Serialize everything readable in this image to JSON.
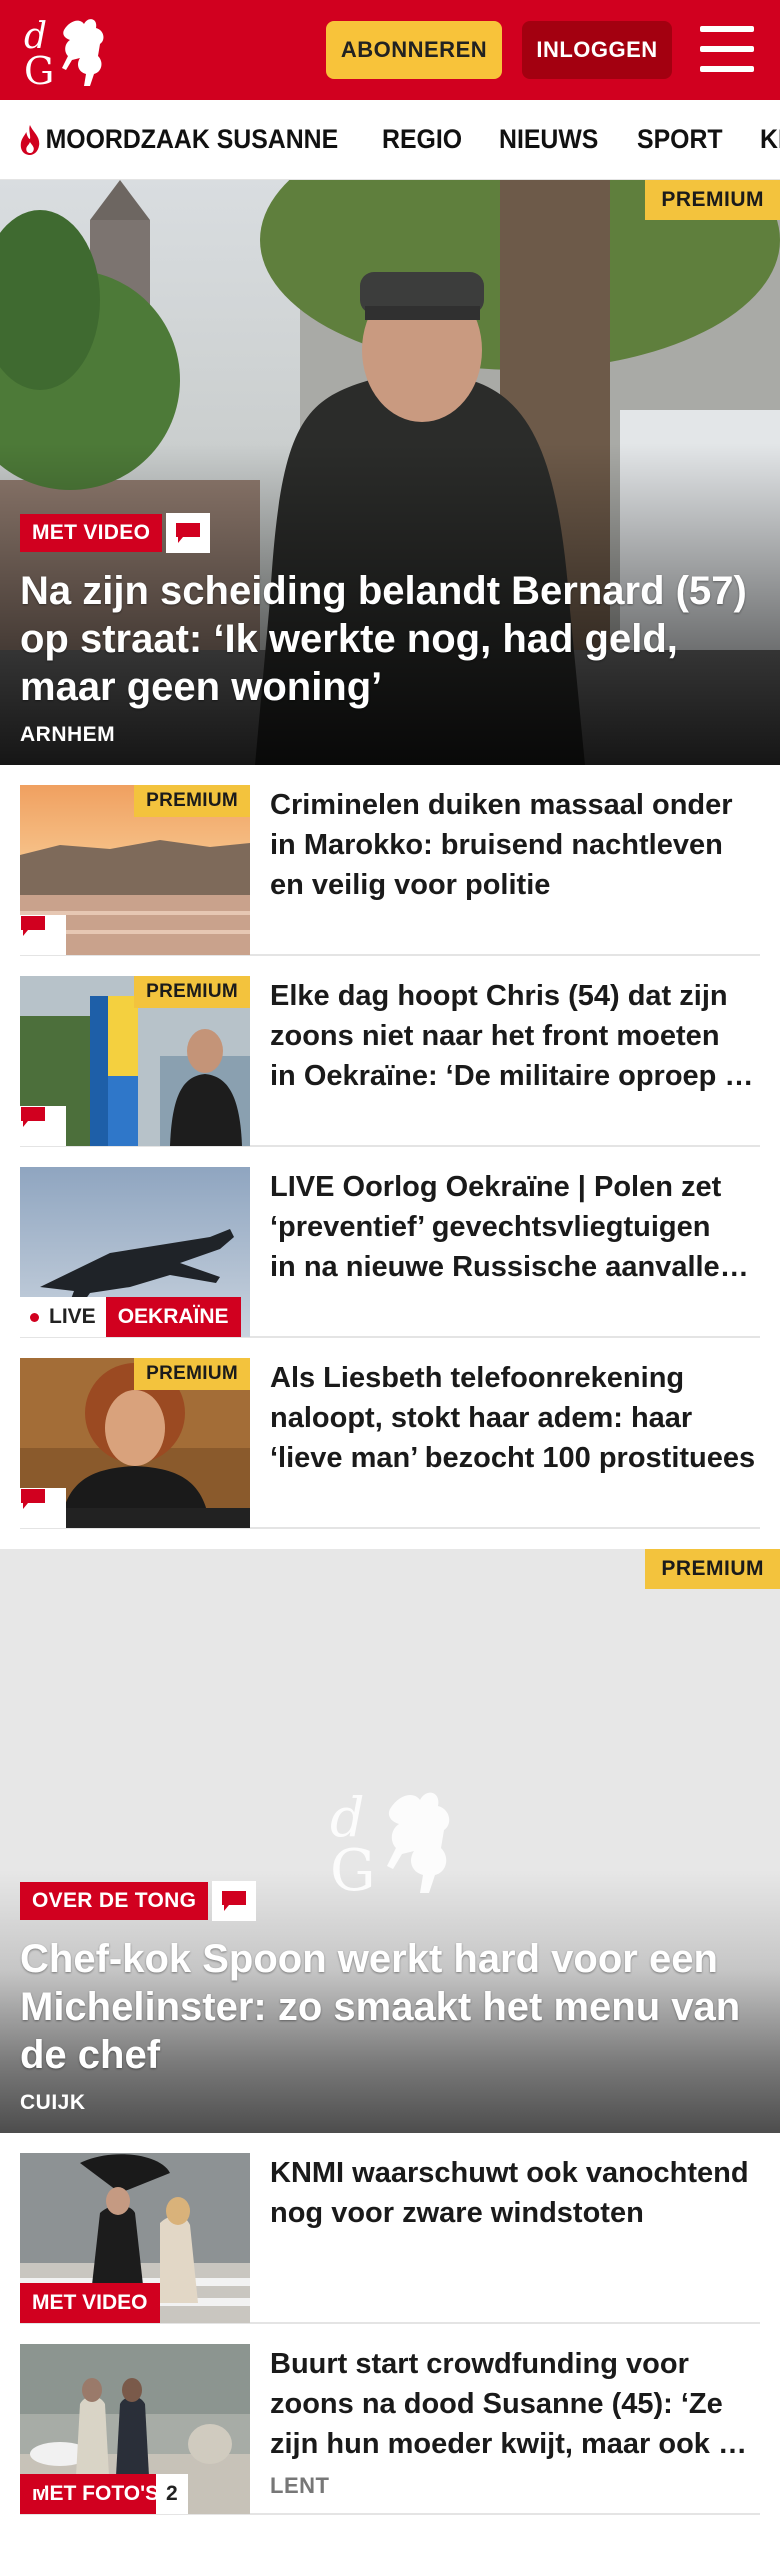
{
  "header": {
    "logo_text": "dG",
    "subscribe_label": "ABONNEREN",
    "login_label": "INLOGGEN",
    "brand_color": "#d1001f",
    "subscribe_color": "#f8c33a",
    "login_color": "#a30010"
  },
  "nav": {
    "items": [
      {
        "label": "MOORDZAAK SUSANNE",
        "icon": "flame-icon"
      },
      {
        "label": "REGIO"
      },
      {
        "label": "NIEUWS"
      },
      {
        "label": "SPORT"
      },
      {
        "label": "KIJK"
      }
    ]
  },
  "hero": {
    "premium_label": "PREMIUM",
    "tag": "MET VIDEO",
    "title": "Na zijn scheiding belandt Bernard (57) op straat: ‘Ik werkte nog, had geld, maar geen woning’",
    "location": "ARNHEM"
  },
  "articles": [
    {
      "title": "Criminelen duiken massaal onder in Marokko: bruisend nachtleven en veilig voor politie",
      "premium_label": "PREMIUM"
    },
    {
      "title_lines": [
        "Elke dag hoopt Chris (54) dat zijn",
        "zoons niet naar het front moeten",
        "in Oekraïne: ‘De militaire oproep voor zijn zoons"
      ],
      "premium_label": "PREMIUM"
    },
    {
      "title_lines": [
        "LIVE Oorlog Oekraïne | Polen zet",
        "‘preventief’ gevechtsvliegtuigen",
        "in na nieuwe Russische aanvallen op Oekraïne"
      ],
      "live_label": "LIVE",
      "tag": "OEKRAÏNE"
    },
    {
      "title_lines": [
        "Als Liesbeth telefoonrekening",
        "naloopt, stokt haar adem: haar",
        "‘lieve man’ bezocht 100 prostituees"
      ],
      "premium_label": "PREMIUM"
    }
  ],
  "feature": {
    "premium_label": "PREMIUM",
    "tag": "OVER DE TONG",
    "title": "Chef-kok Spoon werkt hard voor een Michelinster: zo smaakt het menu van de chef",
    "location": "CUIJK"
  },
  "articles2": [
    {
      "title": "KNMI waarschuwt ook vanochtend nog voor zware windstoten",
      "tag": "MET VIDEO"
    },
    {
      "title_lines": [
        "Buurt start crowdfunding voor",
        "zoons na dood Susanne (45): ‘Ze",
        "zijn hun moeder kwijt, maar ook hun vader’"
      ],
      "tag": "MET FOTO'S",
      "comment_count": "2",
      "location": "LENT"
    }
  ]
}
